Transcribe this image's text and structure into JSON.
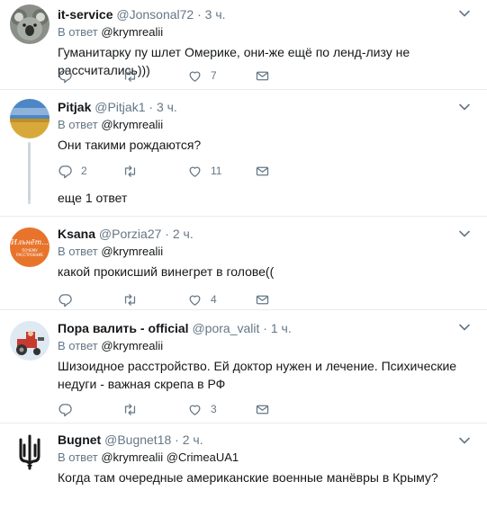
{
  "reply_prefix": "В ответ",
  "tweets": [
    {
      "name": "it-service",
      "handle": "@Jonsonal72",
      "dot": "·",
      "time": "3 ч.",
      "reply_to": "@krymrealii",
      "text": "Гуманитарку пу шлет Омерике, они-же ещё по ленд-лизу не  рассчитались)))",
      "replies": "",
      "retweets": "",
      "likes": "7"
    },
    {
      "name": "Pitjak",
      "handle": "@Pitjak1",
      "dot": "·",
      "time": "3 ч.",
      "reply_to": "@krymrealii",
      "text": "Они такими рождаются?",
      "replies": "2",
      "retweets": "",
      "likes": "11",
      "more_replies": "еще 1 ответ"
    },
    {
      "name": "Ksana",
      "handle": "@Porzia27",
      "dot": "·",
      "time": "2 ч.",
      "reply_to": "@krymrealii",
      "text": "какой прокисший винегрет в голове((",
      "replies": "",
      "retweets": "",
      "likes": "4",
      "avatar_text": "Ильнёт... ПОЧЕМУ РАССТРОЕНИЕ"
    },
    {
      "name": "Пора валить - official",
      "handle": "@pora_valit",
      "dot": "·",
      "time": "1 ч.",
      "reply_to": "@krymrealii",
      "text": "Шизоидное расстройство. Ей доктор нужен и лечение. Психические недуги - важная скрепа в РФ",
      "replies": "",
      "retweets": "",
      "likes": "3"
    },
    {
      "name": "Bugnet",
      "handle": "@Bugnet18",
      "dot": "·",
      "time": "2 ч.",
      "reply_to": "@krymrealii @CrimeaUA1",
      "text": "Когда там очередные американские военные манёвры в Крыму?",
      "replies": "",
      "retweets": "",
      "likes": ""
    }
  ],
  "colors": {
    "text": "#14171a",
    "muted": "#657786",
    "border": "#e6ecf0",
    "thread_line": "#ccd6dd",
    "link": "#1da1f2"
  },
  "icons": {
    "reply": "reply-icon",
    "retweet": "retweet-icon",
    "like": "heart-icon",
    "dm": "envelope-icon",
    "menu": "chevron-down-icon"
  }
}
